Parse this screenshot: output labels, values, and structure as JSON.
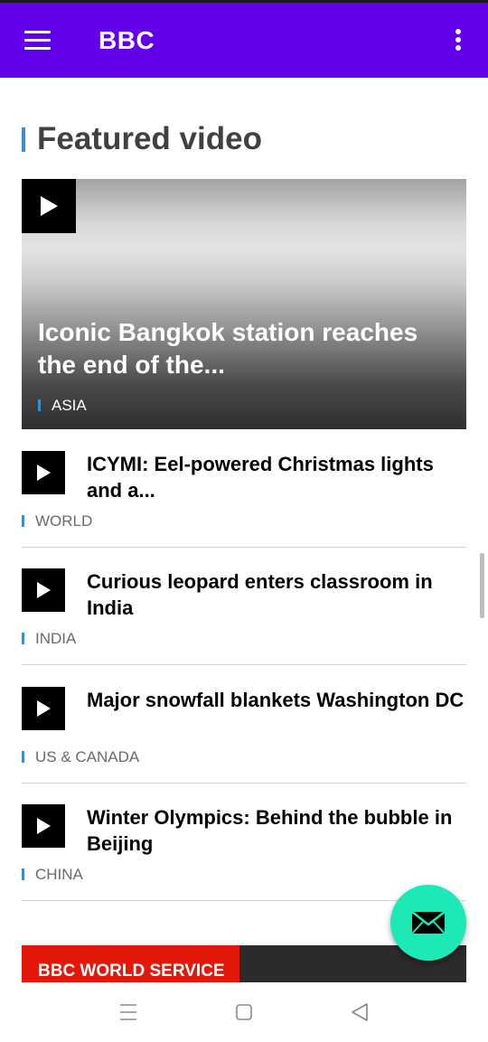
{
  "app_bar": {
    "title": "BBC",
    "background_color": "#6200ea",
    "menu_icon": "hamburger-menu-icon",
    "overflow_icon": "vertical-dots-icon"
  },
  "section": {
    "title": "Featured video",
    "accent_color": "#3b8fd0"
  },
  "featured": {
    "title": "Iconic Bangkok station reaches the end of the...",
    "category": "ASIA",
    "icon": "play-icon"
  },
  "videos": [
    {
      "title": "ICYMI: Eel-powered Christmas lights and a...",
      "category": "WORLD"
    },
    {
      "title": "Curious leopard enters classroom in India",
      "category": "INDIA"
    },
    {
      "title": "Major snowfall blankets Washington DC",
      "category": "US & CANADA"
    },
    {
      "title": "Winter Olympics: Behind the bubble in Beijing",
      "category": "CHINA"
    }
  ],
  "promo": {
    "label": "BBC WORLD SERVICE",
    "color": "#e3170a"
  },
  "fab": {
    "icon": "mail-icon",
    "color": "#1de9b6"
  },
  "system_nav": {
    "icons": [
      "recents-icon",
      "home-icon",
      "back-icon"
    ]
  }
}
